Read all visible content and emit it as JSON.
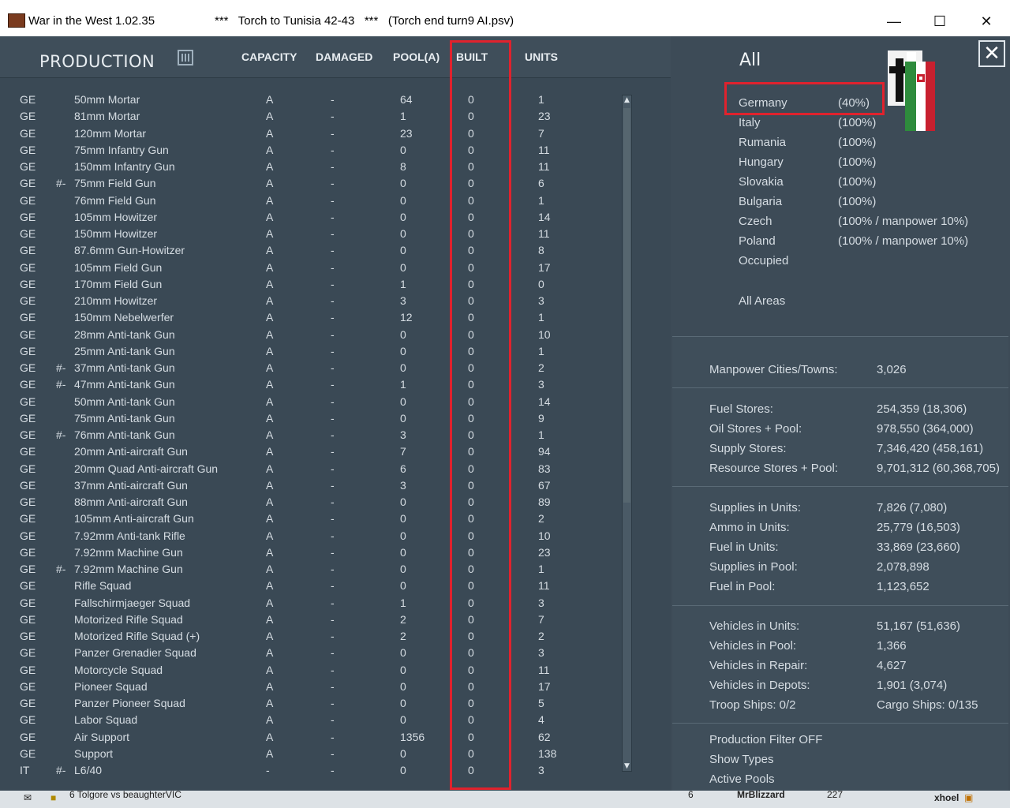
{
  "window": {
    "app_title": "War in the West  1.02.35",
    "scenario_title": "***   Torch to Tunisia 42-43   ***   (Torch end turn9 AI.psv)",
    "minimize": "—",
    "maximize": "☐",
    "close": "✕"
  },
  "production": {
    "title": "PRODUCTION",
    "columns": {
      "capacity": "CAPACITY",
      "damaged": "DAMAGED",
      "pool": "POOL(A)",
      "built": "BUILT",
      "units": "UNITS"
    },
    "rows": [
      {
        "nat": "GE",
        "flag": "",
        "name": "50mm Mortar",
        "cap": "A",
        "dam": "-",
        "pool": "64",
        "built": "0",
        "units": "1"
      },
      {
        "nat": "GE",
        "flag": "",
        "name": "81mm Mortar",
        "cap": "A",
        "dam": "-",
        "pool": "1",
        "built": "0",
        "units": "23"
      },
      {
        "nat": "GE",
        "flag": "",
        "name": "120mm Mortar",
        "cap": "A",
        "dam": "-",
        "pool": "23",
        "built": "0",
        "units": "7"
      },
      {
        "nat": "GE",
        "flag": "",
        "name": "75mm Infantry Gun",
        "cap": "A",
        "dam": "-",
        "pool": "0",
        "built": "0",
        "units": "11"
      },
      {
        "nat": "GE",
        "flag": "",
        "name": "150mm Infantry Gun",
        "cap": "A",
        "dam": "-",
        "pool": "8",
        "built": "0",
        "units": "11"
      },
      {
        "nat": "GE",
        "flag": "#-",
        "name": "75mm Field Gun",
        "cap": "A",
        "dam": "-",
        "pool": "0",
        "built": "0",
        "units": "6"
      },
      {
        "nat": "GE",
        "flag": "",
        "name": "76mm Field Gun",
        "cap": "A",
        "dam": "-",
        "pool": "0",
        "built": "0",
        "units": "1"
      },
      {
        "nat": "GE",
        "flag": "",
        "name": "105mm Howitzer",
        "cap": "A",
        "dam": "-",
        "pool": "0",
        "built": "0",
        "units": "14"
      },
      {
        "nat": "GE",
        "flag": "",
        "name": "150mm Howitzer",
        "cap": "A",
        "dam": "-",
        "pool": "0",
        "built": "0",
        "units": "11"
      },
      {
        "nat": "GE",
        "flag": "",
        "name": "87.6mm Gun-Howitzer",
        "cap": "A",
        "dam": "-",
        "pool": "0",
        "built": "0",
        "units": "8"
      },
      {
        "nat": "GE",
        "flag": "",
        "name": "105mm Field Gun",
        "cap": "A",
        "dam": "-",
        "pool": "0",
        "built": "0",
        "units": "17"
      },
      {
        "nat": "GE",
        "flag": "",
        "name": "170mm Field Gun",
        "cap": "A",
        "dam": "-",
        "pool": "1",
        "built": "0",
        "units": "0"
      },
      {
        "nat": "GE",
        "flag": "",
        "name": "210mm Howitzer",
        "cap": "A",
        "dam": "-",
        "pool": "3",
        "built": "0",
        "units": "3"
      },
      {
        "nat": "GE",
        "flag": "",
        "name": "150mm Nebelwerfer",
        "cap": "A",
        "dam": "-",
        "pool": "12",
        "built": "0",
        "units": "1"
      },
      {
        "nat": "GE",
        "flag": "",
        "name": "28mm Anti-tank Gun",
        "cap": "A",
        "dam": "-",
        "pool": "0",
        "built": "0",
        "units": "10"
      },
      {
        "nat": "GE",
        "flag": "",
        "name": "25mm Anti-tank Gun",
        "cap": "A",
        "dam": "-",
        "pool": "0",
        "built": "0",
        "units": "1"
      },
      {
        "nat": "GE",
        "flag": "#-",
        "name": "37mm Anti-tank Gun",
        "cap": "A",
        "dam": "-",
        "pool": "0",
        "built": "0",
        "units": "2"
      },
      {
        "nat": "GE",
        "flag": "#-",
        "name": "47mm Anti-tank Gun",
        "cap": "A",
        "dam": "-",
        "pool": "1",
        "built": "0",
        "units": "3"
      },
      {
        "nat": "GE",
        "flag": "",
        "name": "50mm Anti-tank Gun",
        "cap": "A",
        "dam": "-",
        "pool": "0",
        "built": "0",
        "units": "14"
      },
      {
        "nat": "GE",
        "flag": "",
        "name": "75mm Anti-tank Gun",
        "cap": "A",
        "dam": "-",
        "pool": "0",
        "built": "0",
        "units": "9"
      },
      {
        "nat": "GE",
        "flag": "#-",
        "name": "76mm Anti-tank Gun",
        "cap": "A",
        "dam": "-",
        "pool": "3",
        "built": "0",
        "units": "1"
      },
      {
        "nat": "GE",
        "flag": "",
        "name": "20mm Anti-aircraft Gun",
        "cap": "A",
        "dam": "-",
        "pool": "7",
        "built": "0",
        "units": "94"
      },
      {
        "nat": "GE",
        "flag": "",
        "name": "20mm Quad Anti-aircraft Gun",
        "cap": "A",
        "dam": "-",
        "pool": "6",
        "built": "0",
        "units": "83"
      },
      {
        "nat": "GE",
        "flag": "",
        "name": "37mm Anti-aircraft Gun",
        "cap": "A",
        "dam": "-",
        "pool": "3",
        "built": "0",
        "units": "67"
      },
      {
        "nat": "GE",
        "flag": "",
        "name": "88mm Anti-aircraft Gun",
        "cap": "A",
        "dam": "-",
        "pool": "0",
        "built": "0",
        "units": "89"
      },
      {
        "nat": "GE",
        "flag": "",
        "name": "105mm Anti-aircraft Gun",
        "cap": "A",
        "dam": "-",
        "pool": "0",
        "built": "0",
        "units": "2"
      },
      {
        "nat": "GE",
        "flag": "",
        "name": "7.92mm Anti-tank Rifle",
        "cap": "A",
        "dam": "-",
        "pool": "0",
        "built": "0",
        "units": "10"
      },
      {
        "nat": "GE",
        "flag": "",
        "name": "7.92mm Machine Gun",
        "cap": "A",
        "dam": "-",
        "pool": "0",
        "built": "0",
        "units": "23"
      },
      {
        "nat": "GE",
        "flag": "#-",
        "name": "7.92mm Machine Gun",
        "cap": "A",
        "dam": "-",
        "pool": "0",
        "built": "0",
        "units": "1"
      },
      {
        "nat": "GE",
        "flag": "",
        "name": "Rifle Squad",
        "cap": "A",
        "dam": "-",
        "pool": "0",
        "built": "0",
        "units": "11"
      },
      {
        "nat": "GE",
        "flag": "",
        "name": "Fallschirmjaeger Squad",
        "cap": "A",
        "dam": "-",
        "pool": "1",
        "built": "0",
        "units": "3"
      },
      {
        "nat": "GE",
        "flag": "",
        "name": "Motorized Rifle Squad",
        "cap": "A",
        "dam": "-",
        "pool": "2",
        "built": "0",
        "units": "7"
      },
      {
        "nat": "GE",
        "flag": "",
        "name": "Motorized Rifle Squad (+)",
        "cap": "A",
        "dam": "-",
        "pool": "2",
        "built": "0",
        "units": "2"
      },
      {
        "nat": "GE",
        "flag": "",
        "name": "Panzer Grenadier Squad",
        "cap": "A",
        "dam": "-",
        "pool": "0",
        "built": "0",
        "units": "3"
      },
      {
        "nat": "GE",
        "flag": "",
        "name": "Motorcycle Squad",
        "cap": "A",
        "dam": "-",
        "pool": "0",
        "built": "0",
        "units": "11"
      },
      {
        "nat": "GE",
        "flag": "",
        "name": "Pioneer Squad",
        "cap": "A",
        "dam": "-",
        "pool": "0",
        "built": "0",
        "units": "17"
      },
      {
        "nat": "GE",
        "flag": "",
        "name": "Panzer Pioneer Squad",
        "cap": "A",
        "dam": "-",
        "pool": "0",
        "built": "0",
        "units": "5"
      },
      {
        "nat": "GE",
        "flag": "",
        "name": "Labor Squad",
        "cap": "A",
        "dam": "-",
        "pool": "0",
        "built": "0",
        "units": "4"
      },
      {
        "nat": "GE",
        "flag": "",
        "name": "Air Support",
        "cap": "A",
        "dam": "-",
        "pool": "1356",
        "built": "0",
        "units": "62"
      },
      {
        "nat": "GE",
        "flag": "",
        "name": "Support",
        "cap": "A",
        "dam": "-",
        "pool": "0",
        "built": "0",
        "units": "138"
      },
      {
        "nat": "IT",
        "flag": "#-",
        "name": "L6/40",
        "cap": "-",
        "dam": "-",
        "pool": "0",
        "built": "0",
        "units": "3"
      }
    ]
  },
  "nations": {
    "all_label": "All",
    "list": [
      {
        "name": "Germany",
        "pct": "(40%)"
      },
      {
        "name": "Italy",
        "pct": "(100%)"
      },
      {
        "name": "Rumania",
        "pct": "(100%)"
      },
      {
        "name": "Hungary",
        "pct": "(100%)"
      },
      {
        "name": "Slovakia",
        "pct": "(100%)"
      },
      {
        "name": "Bulgaria",
        "pct": "(100%)"
      },
      {
        "name": "Czech",
        "pct": "(100% / manpower 10%)"
      },
      {
        "name": "Poland",
        "pct": "(100% / manpower 10%)"
      },
      {
        "name": "Occupied",
        "pct": ""
      }
    ],
    "all_areas": "All Areas"
  },
  "stats": {
    "manpower": [
      {
        "label": "Manpower Cities/Towns:",
        "value": "3,026"
      }
    ],
    "stores": [
      {
        "label": "Fuel Stores:",
        "value": "254,359 (18,306)"
      },
      {
        "label": "Oil Stores + Pool:",
        "value": "978,550 (364,000)"
      },
      {
        "label": "Supply Stores:",
        "value": "7,346,420 (458,161)"
      },
      {
        "label": "Resource Stores + Pool:",
        "value": "9,701,312 (60,368,705)"
      }
    ],
    "units": [
      {
        "label": "Supplies in Units:",
        "value": "7,826 (7,080)"
      },
      {
        "label": "Ammo in Units:",
        "value": "25,779 (16,503)"
      },
      {
        "label": "Fuel in Units:",
        "value": "33,869 (23,660)"
      },
      {
        "label": "Supplies in Pool:",
        "value": "2,078,898"
      },
      {
        "label": "Fuel in Pool:",
        "value": "1,123,652"
      }
    ],
    "vehicles": [
      {
        "label": "Vehicles in Units:",
        "value": "51,167 (51,636)"
      },
      {
        "label": "Vehicles in Pool:",
        "value": "1,366"
      },
      {
        "label": "Vehicles in Repair:",
        "value": "4,627"
      },
      {
        "label": "Vehicles in Depots:",
        "value": "1,901 (3,074)"
      },
      {
        "label": "Troop Ships: 0/2",
        "value": "Cargo Ships: 0/135"
      }
    ]
  },
  "actions": {
    "production_filter": "Production Filter OFF",
    "show_types": "Show Types",
    "active_pools": "Active Pools"
  },
  "taskbar": {
    "item_text": "6 Tolgore vs beaughterVIC",
    "count": "6",
    "player": "MrBlizzard",
    "number": "227",
    "user": "xhoel"
  },
  "colors": {
    "highlight": "#e0222d",
    "panel": "#3a4955",
    "text": "#d6dde3"
  }
}
